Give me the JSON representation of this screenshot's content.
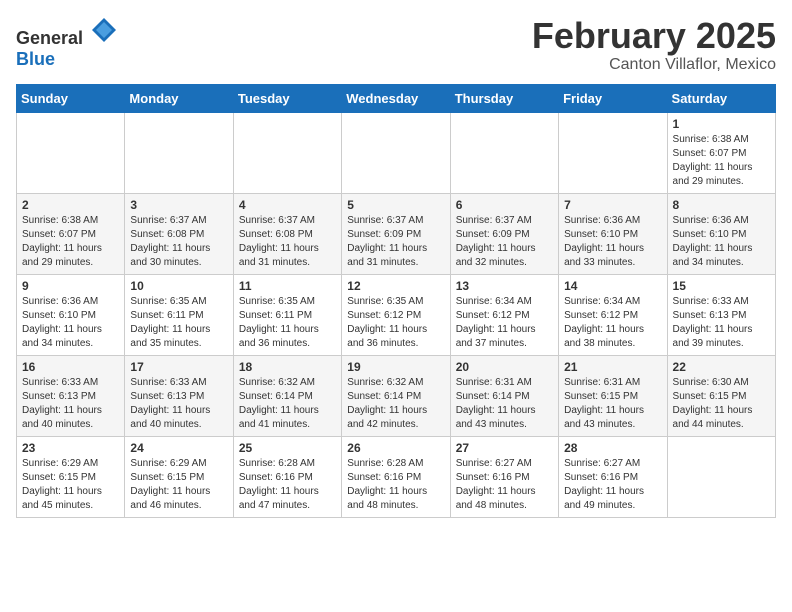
{
  "header": {
    "logo_general": "General",
    "logo_blue": "Blue",
    "month": "February 2025",
    "location": "Canton Villaflor, Mexico"
  },
  "weekdays": [
    "Sunday",
    "Monday",
    "Tuesday",
    "Wednesday",
    "Thursday",
    "Friday",
    "Saturday"
  ],
  "weeks": [
    [
      {
        "day": "",
        "info": ""
      },
      {
        "day": "",
        "info": ""
      },
      {
        "day": "",
        "info": ""
      },
      {
        "day": "",
        "info": ""
      },
      {
        "day": "",
        "info": ""
      },
      {
        "day": "",
        "info": ""
      },
      {
        "day": "1",
        "info": "Sunrise: 6:38 AM\nSunset: 6:07 PM\nDaylight: 11 hours\nand 29 minutes."
      }
    ],
    [
      {
        "day": "2",
        "info": "Sunrise: 6:38 AM\nSunset: 6:07 PM\nDaylight: 11 hours\nand 29 minutes."
      },
      {
        "day": "3",
        "info": "Sunrise: 6:37 AM\nSunset: 6:08 PM\nDaylight: 11 hours\nand 30 minutes."
      },
      {
        "day": "4",
        "info": "Sunrise: 6:37 AM\nSunset: 6:08 PM\nDaylight: 11 hours\nand 31 minutes."
      },
      {
        "day": "5",
        "info": "Sunrise: 6:37 AM\nSunset: 6:09 PM\nDaylight: 11 hours\nand 31 minutes."
      },
      {
        "day": "6",
        "info": "Sunrise: 6:37 AM\nSunset: 6:09 PM\nDaylight: 11 hours\nand 32 minutes."
      },
      {
        "day": "7",
        "info": "Sunrise: 6:36 AM\nSunset: 6:10 PM\nDaylight: 11 hours\nand 33 minutes."
      },
      {
        "day": "8",
        "info": "Sunrise: 6:36 AM\nSunset: 6:10 PM\nDaylight: 11 hours\nand 34 minutes."
      }
    ],
    [
      {
        "day": "9",
        "info": "Sunrise: 6:36 AM\nSunset: 6:10 PM\nDaylight: 11 hours\nand 34 minutes."
      },
      {
        "day": "10",
        "info": "Sunrise: 6:35 AM\nSunset: 6:11 PM\nDaylight: 11 hours\nand 35 minutes."
      },
      {
        "day": "11",
        "info": "Sunrise: 6:35 AM\nSunset: 6:11 PM\nDaylight: 11 hours\nand 36 minutes."
      },
      {
        "day": "12",
        "info": "Sunrise: 6:35 AM\nSunset: 6:12 PM\nDaylight: 11 hours\nand 36 minutes."
      },
      {
        "day": "13",
        "info": "Sunrise: 6:34 AM\nSunset: 6:12 PM\nDaylight: 11 hours\nand 37 minutes."
      },
      {
        "day": "14",
        "info": "Sunrise: 6:34 AM\nSunset: 6:12 PM\nDaylight: 11 hours\nand 38 minutes."
      },
      {
        "day": "15",
        "info": "Sunrise: 6:33 AM\nSunset: 6:13 PM\nDaylight: 11 hours\nand 39 minutes."
      }
    ],
    [
      {
        "day": "16",
        "info": "Sunrise: 6:33 AM\nSunset: 6:13 PM\nDaylight: 11 hours\nand 40 minutes."
      },
      {
        "day": "17",
        "info": "Sunrise: 6:33 AM\nSunset: 6:13 PM\nDaylight: 11 hours\nand 40 minutes."
      },
      {
        "day": "18",
        "info": "Sunrise: 6:32 AM\nSunset: 6:14 PM\nDaylight: 11 hours\nand 41 minutes."
      },
      {
        "day": "19",
        "info": "Sunrise: 6:32 AM\nSunset: 6:14 PM\nDaylight: 11 hours\nand 42 minutes."
      },
      {
        "day": "20",
        "info": "Sunrise: 6:31 AM\nSunset: 6:14 PM\nDaylight: 11 hours\nand 43 minutes."
      },
      {
        "day": "21",
        "info": "Sunrise: 6:31 AM\nSunset: 6:15 PM\nDaylight: 11 hours\nand 43 minutes."
      },
      {
        "day": "22",
        "info": "Sunrise: 6:30 AM\nSunset: 6:15 PM\nDaylight: 11 hours\nand 44 minutes."
      }
    ],
    [
      {
        "day": "23",
        "info": "Sunrise: 6:29 AM\nSunset: 6:15 PM\nDaylight: 11 hours\nand 45 minutes."
      },
      {
        "day": "24",
        "info": "Sunrise: 6:29 AM\nSunset: 6:15 PM\nDaylight: 11 hours\nand 46 minutes."
      },
      {
        "day": "25",
        "info": "Sunrise: 6:28 AM\nSunset: 6:16 PM\nDaylight: 11 hours\nand 47 minutes."
      },
      {
        "day": "26",
        "info": "Sunrise: 6:28 AM\nSunset: 6:16 PM\nDaylight: 11 hours\nand 48 minutes."
      },
      {
        "day": "27",
        "info": "Sunrise: 6:27 AM\nSunset: 6:16 PM\nDaylight: 11 hours\nand 48 minutes."
      },
      {
        "day": "28",
        "info": "Sunrise: 6:27 AM\nSunset: 6:16 PM\nDaylight: 11 hours\nand 49 minutes."
      },
      {
        "day": "",
        "info": ""
      }
    ]
  ]
}
